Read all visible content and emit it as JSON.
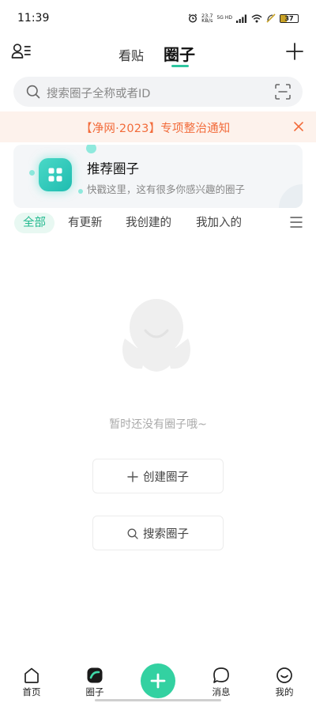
{
  "status_bar": {
    "time": "11:39",
    "net_speed_value": "23.7",
    "net_speed_unit": "KB/s",
    "network_gen": "5G HD",
    "battery_level": "37"
  },
  "header": {
    "tab_posts": "看贴",
    "tab_circles": "圈子",
    "active_tab": "圈子"
  },
  "search": {
    "placeholder": "搜索圈子全称或者ID"
  },
  "notice": {
    "text": "【净网·2023】专项整治通知"
  },
  "recommend": {
    "title": "推荐圈子",
    "subtitle": "快戳这里，这有很多你感兴趣的圈子"
  },
  "filters": [
    {
      "label": "全部",
      "active": true
    },
    {
      "label": "有更新",
      "active": false
    },
    {
      "label": "我创建的",
      "active": false
    },
    {
      "label": "我加入的",
      "active": false
    }
  ],
  "empty_state": {
    "message": "暂时还没有圈子哦~",
    "create_label": "创建圈子",
    "search_label": "搜索圈子"
  },
  "bottom_nav": {
    "items": [
      {
        "label": "首页",
        "icon": "home-icon"
      },
      {
        "label": "圈子",
        "icon": "circle-icon",
        "active": true
      },
      {
        "label": "",
        "icon": "add-icon"
      },
      {
        "label": "消息",
        "icon": "message-icon"
      },
      {
        "label": "我的",
        "icon": "profile-icon"
      }
    ]
  },
  "colors": {
    "accent": "#2fc6a0",
    "notice_text": "#f26b3a",
    "notice_bg": "#fdf2ec",
    "fab": "#33d1a1"
  }
}
